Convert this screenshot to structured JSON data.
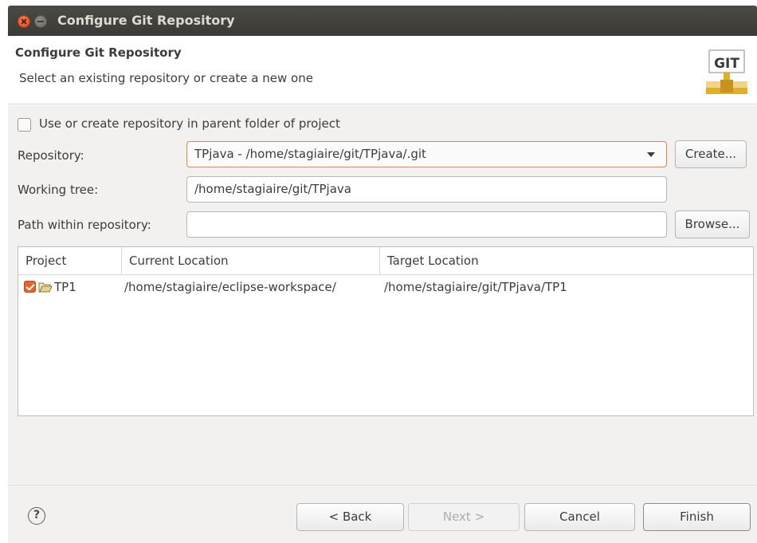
{
  "window": {
    "title": "Configure Git Repository"
  },
  "banner": {
    "title": "Configure Git Repository",
    "description": "Select an existing repository or create a new one",
    "logo_text": "GIT"
  },
  "form": {
    "parent_checkbox_label": "Use or create repository in parent folder of project",
    "parent_checkbox_checked": false,
    "repository_label": "Repository:",
    "repository_value": "TPjava - /home/stagiaire/git/TPjava/.git",
    "create_button": "Create...",
    "working_tree_label": "Working tree:",
    "working_tree_value": "/home/stagiaire/git/TPjava",
    "path_label": "Path within repository:",
    "path_value": "",
    "browse_button": "Browse..."
  },
  "table": {
    "columns": [
      "Project",
      "Current Location",
      "Target Location"
    ],
    "rows": [
      {
        "checked": true,
        "project": "TP1",
        "current_location": "/home/stagiaire/eclipse-workspace/",
        "target_location": "/home/stagiaire/git/TPjava/TP1"
      }
    ]
  },
  "footer": {
    "help_icon": "?",
    "back_button": "< Back",
    "next_button": "Next >",
    "cancel_button": "Cancel",
    "finish_button": "Finish"
  },
  "colors": {
    "accent": "#e5632b",
    "titlebar": "#3e3d39"
  }
}
